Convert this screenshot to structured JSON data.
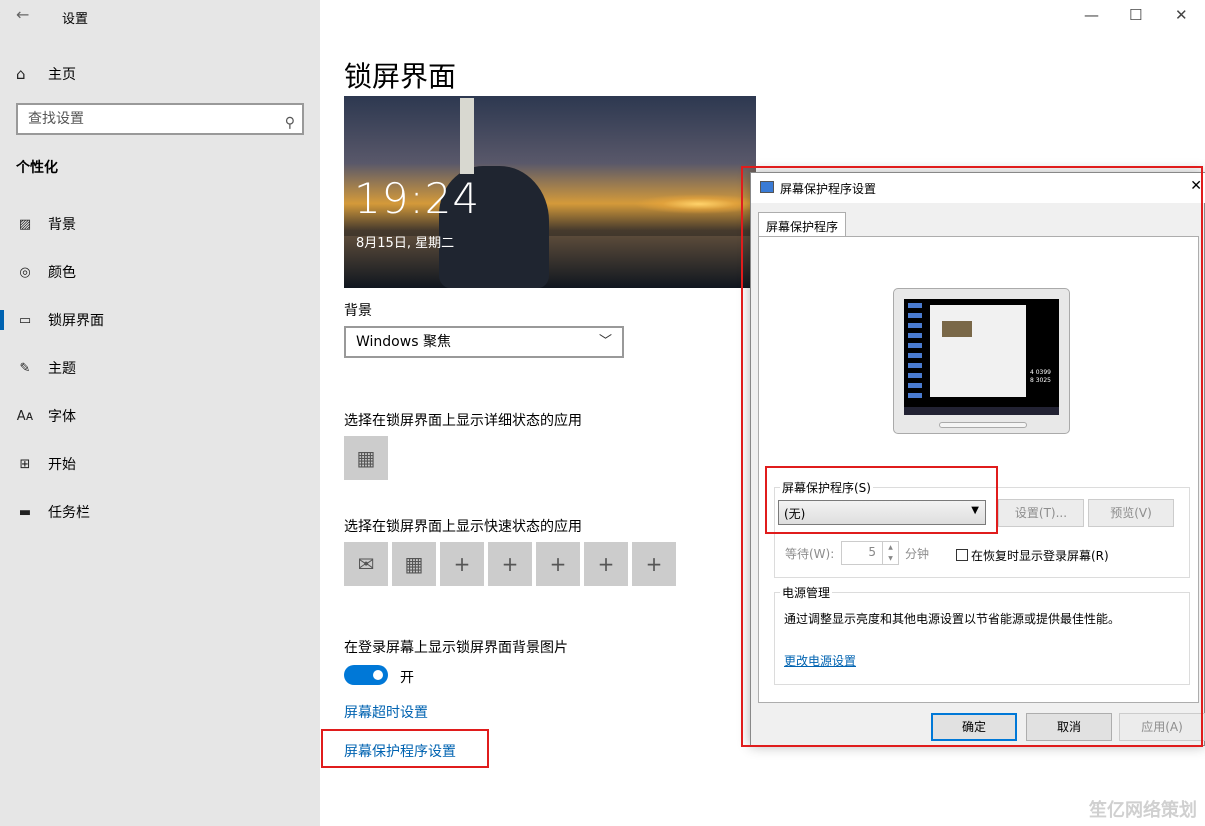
{
  "app": {
    "title": "设置",
    "back_icon": "back-arrow-icon"
  },
  "sidebar": {
    "home_label": "主页",
    "search_placeholder": "查找设置",
    "section_title": "个性化",
    "items": [
      {
        "label": "背景",
        "icon": "picture-icon"
      },
      {
        "label": "颜色",
        "icon": "palette-icon"
      },
      {
        "label": "锁屏界面",
        "icon": "lock-screen-icon",
        "active": true
      },
      {
        "label": "主题",
        "icon": "brush-icon"
      },
      {
        "label": "字体",
        "icon": "font-icon"
      },
      {
        "label": "开始",
        "icon": "start-icon"
      },
      {
        "label": "任务栏",
        "icon": "taskbar-icon"
      }
    ]
  },
  "window_controls": {
    "minimize": "—",
    "maximize": "☐",
    "close": "✕"
  },
  "main": {
    "title": "锁屏界面",
    "preview": {
      "time": "19:24",
      "date": "8月15日, 星期二"
    },
    "background_label": "背景",
    "background_value": "Windows 聚焦",
    "detailed_label": "选择在锁屏界面上显示详细状态的应用",
    "quick_label": "选择在锁屏界面上显示快速状态的应用",
    "signin_label": "在登录屏幕上显示锁屏界面背景图片",
    "toggle_state": "开",
    "link_timeout": "屏幕超时设置",
    "link_screensaver": "屏幕保护程序设置"
  },
  "dialog": {
    "title": "屏幕保护程序设置",
    "tab": "屏幕保护程序",
    "preview_nums": [
      "4 0399",
      "8 3025"
    ],
    "screensaver_group": "屏幕保护程序(S)",
    "screensaver_value": "(无)",
    "settings_btn": "设置(T)...",
    "preview_btn": "预览(V)",
    "wait_label": "等待(W):",
    "wait_value": "5",
    "minutes_label": "分钟",
    "resume_label": "在恢复时显示登录屏幕(R)",
    "power_group": "电源管理",
    "power_desc": "通过调整显示亮度和其他电源设置以节省能源或提供最佳性能。",
    "power_link": "更改电源设置",
    "ok": "确定",
    "cancel": "取消",
    "apply": "应用(A)"
  },
  "watermark": "笙亿网络策划",
  "colors": {
    "accent": "#0078d7",
    "link": "#0063b1",
    "highlight": "#e01c1c"
  }
}
